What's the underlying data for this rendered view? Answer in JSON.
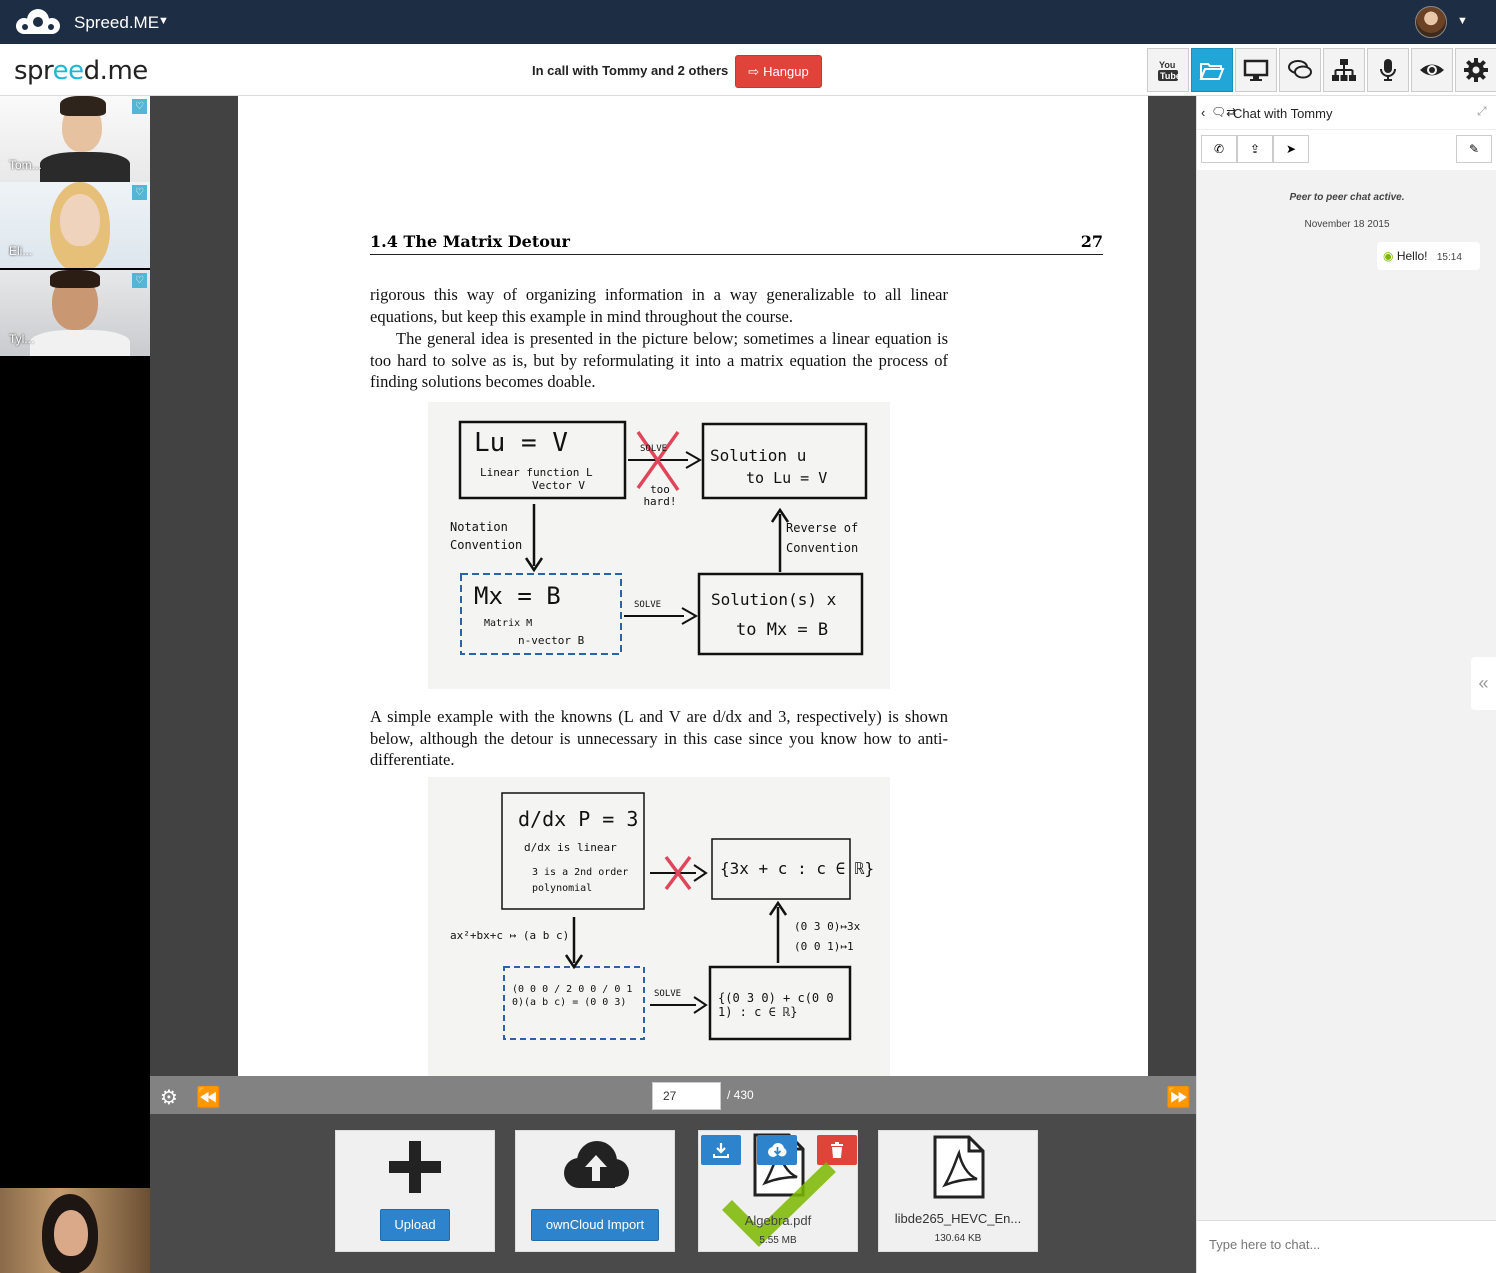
{
  "topbar": {
    "app_name": "Spreed.ME"
  },
  "header": {
    "logo_left": "spr",
    "logo_mid": "ee",
    "logo_right": "d.me",
    "call_status": "In call with Tommy and 2 others",
    "hangup_label": "Hangup",
    "toolbar": [
      "youtube-icon",
      "folder-icon",
      "screen-share-icon",
      "chat-icon",
      "network-icon",
      "microphone-icon",
      "eye-icon",
      "gear-icon"
    ]
  },
  "videos": [
    {
      "name": "Tom..."
    },
    {
      "name": "Eli..."
    },
    {
      "name": "Tyl..."
    }
  ],
  "document": {
    "section": "1.4 The Matrix Detour",
    "page_no": "27",
    "para1": "rigorous this way of organizing information in a way generalizable to all linear equations, but keep this example in mind throughout the course.",
    "para2": "The general idea is presented in the picture below; sometimes a linear equation is too hard to solve as is, but by reformulating it into a matrix equation the process of finding solutions becomes doable.",
    "para3": "A simple example with the knowns (L and V are d/dx and 3, respectively) is shown below, although the detour is unnecessary in this case since you know how to anti-differentiate.",
    "fig1": {
      "box1_main": "Lu = V",
      "box1_sub1": "Linear function L",
      "box1_sub2": "Vector V",
      "solve_crossed": "SOLVE",
      "too_hard": "too hard!",
      "box2_main": "Solution u",
      "box2_sub": "to Lu = V",
      "notation": "Notation Convention",
      "reverse": "Reverse of Convention",
      "box3_main": "Mx = B",
      "box3_sub1": "Matrix M",
      "box3_sub2": "n-vector B",
      "solve": "SOLVE",
      "box4_main": "Solution(s) x",
      "box4_sub": "to Mx = B"
    },
    "fig2": {
      "box1_main": "d/dx P = 3",
      "box1_sub1": "d/dx is linear",
      "box1_sub2": "3 is a 2nd order polynomial",
      "box2_main": "{3x + c : c ∈ ℝ}",
      "left_map": "ax²+bx+c ↦ (a b c)",
      "right_map": "(0 3 0)↦3x  (0 0 1)↦1",
      "box3_main": "(0 0 0 / 2 0 0 / 0 1 0)(a b c) = (0 0 3)",
      "solve": "SOLVE",
      "box4_main": "{(0 3 0) + c(0 0 1) : c ∈ ℝ}"
    }
  },
  "pager": {
    "current": "27",
    "total": "/ 430"
  },
  "files": {
    "upload_label": "Upload",
    "owncloud_label": "ownCloud Import",
    "file1_name": "Algebra.pdf",
    "file1_size": "5.55 MB",
    "file2_name": "libde265_HEVC_En...",
    "file2_size": "130.64 KB"
  },
  "chat": {
    "title": "Chat with Tommy",
    "status": "Peer to peer chat active.",
    "date": "November 18 2015",
    "message": "Hello!",
    "time": "15:14",
    "input_placeholder": "Type here to chat..."
  },
  "colors": {
    "topbar": "#1d2d44",
    "accent": "#21a6d7",
    "hangup": "#e0433a",
    "upload_button": "#2e84cc",
    "delete_button": "#e0433a",
    "online": "#7cb900"
  }
}
